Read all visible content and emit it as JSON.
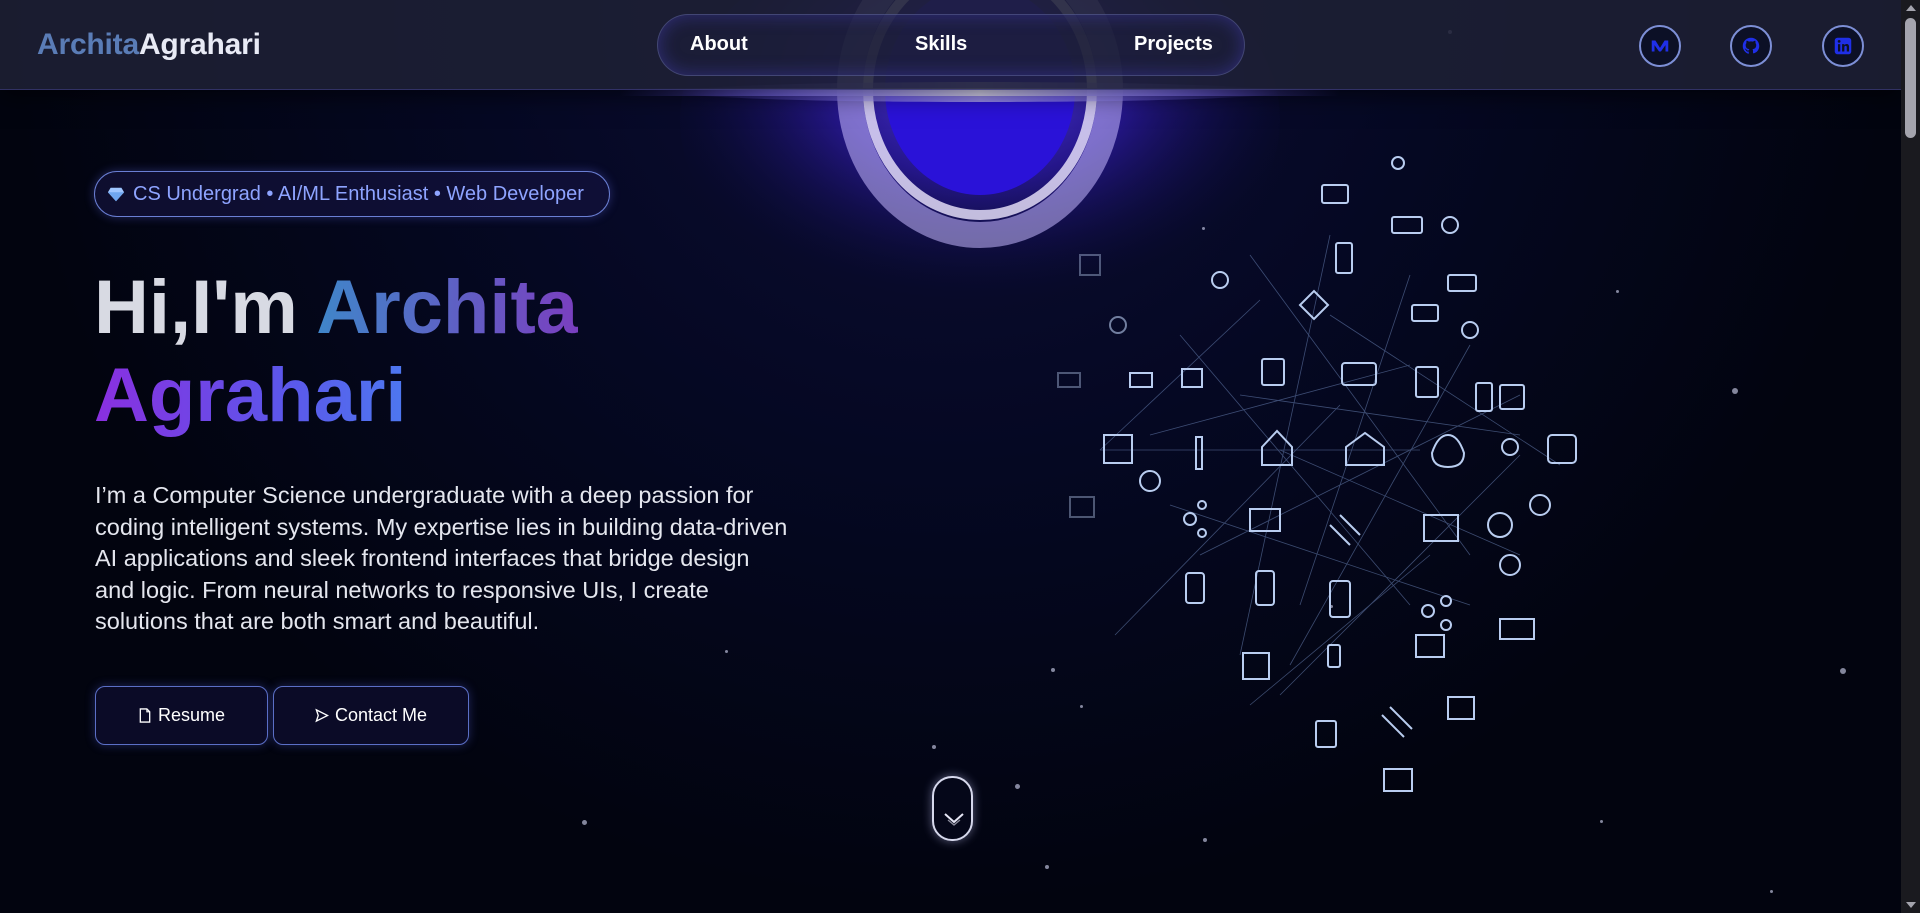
{
  "header": {
    "logo_first": "Archita",
    "logo_last": "Agrahari",
    "nav": [
      "About",
      "Skills",
      "Projects"
    ],
    "social": [
      {
        "icon": "medium-icon"
      },
      {
        "icon": "github-icon"
      },
      {
        "icon": "linkedin-icon"
      }
    ]
  },
  "hero": {
    "tagline": "CS Undergrad • AI/ML Enthusiast • Web Developer",
    "greeting": "Hi,I'm",
    "name_first": "Archita",
    "name_last": "Agrahari",
    "description": "I’m a Computer Science undergraduate with a deep passion for coding intelligent systems. My expertise lies in building data-driven AI applications and sleek frontend interfaces that bridge design and logic. From neural networks to responsive UIs, I create solutions that are both smart and beautiful.",
    "buttons": {
      "resume": "Resume",
      "contact": "Contact Me"
    }
  },
  "colors": {
    "accent_blue": "#3f86c9",
    "accent_purple": "#8a2fe0",
    "glow": "#5a4cff",
    "background": "#030614"
  }
}
